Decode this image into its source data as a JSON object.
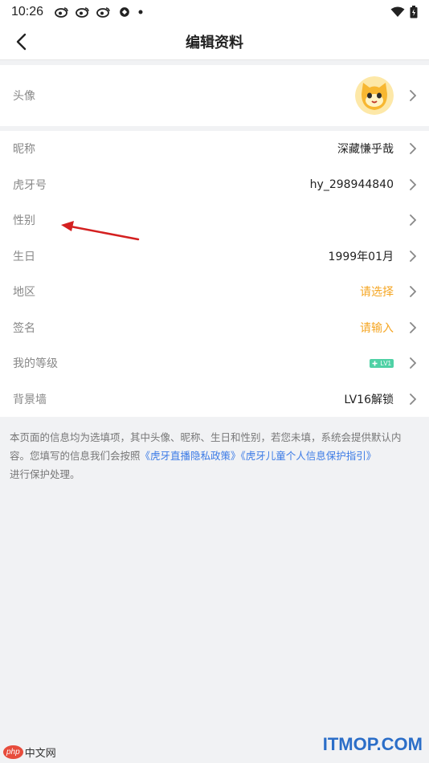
{
  "statusbar": {
    "time": "10:26"
  },
  "header": {
    "title": "编辑资料"
  },
  "profile": {
    "avatar_label": "头像",
    "rows": [
      {
        "label": "昵称",
        "value": "深藏慊乎哉",
        "accent": false
      },
      {
        "label": "虎牙号",
        "value": "hy_298944840",
        "accent": false
      },
      {
        "label": "性别",
        "value": "",
        "accent": false
      },
      {
        "label": "生日",
        "value": "1999年01月",
        "accent": false
      },
      {
        "label": "地区",
        "value": "请选择",
        "accent": true
      },
      {
        "label": "签名",
        "value": "请输入",
        "accent": true
      },
      {
        "label": "我的等级",
        "value": "LV1",
        "accent": false
      },
      {
        "label": "背景墙",
        "value": "LV16解锁",
        "accent": false
      }
    ]
  },
  "notice": {
    "text_1": "本页面的信息均为选填项，其中头像、昵称、生日和性别，若您未填，系统会提供默认内容。您填写的信息我们会按照",
    "link_1": "《虎牙直播隐私政策》",
    "link_2": "《虎牙儿童个人信息保护指引》",
    "text_2": "进行保护处理。"
  },
  "watermarks": {
    "left_logo": "php",
    "left_text": "中文网",
    "right_text": "ITMOP.COM"
  },
  "colors": {
    "accent": "#f5a623",
    "link": "#3c7be6",
    "level_badge": "#4fd1a5",
    "annotation_arrow": "#d42020"
  }
}
